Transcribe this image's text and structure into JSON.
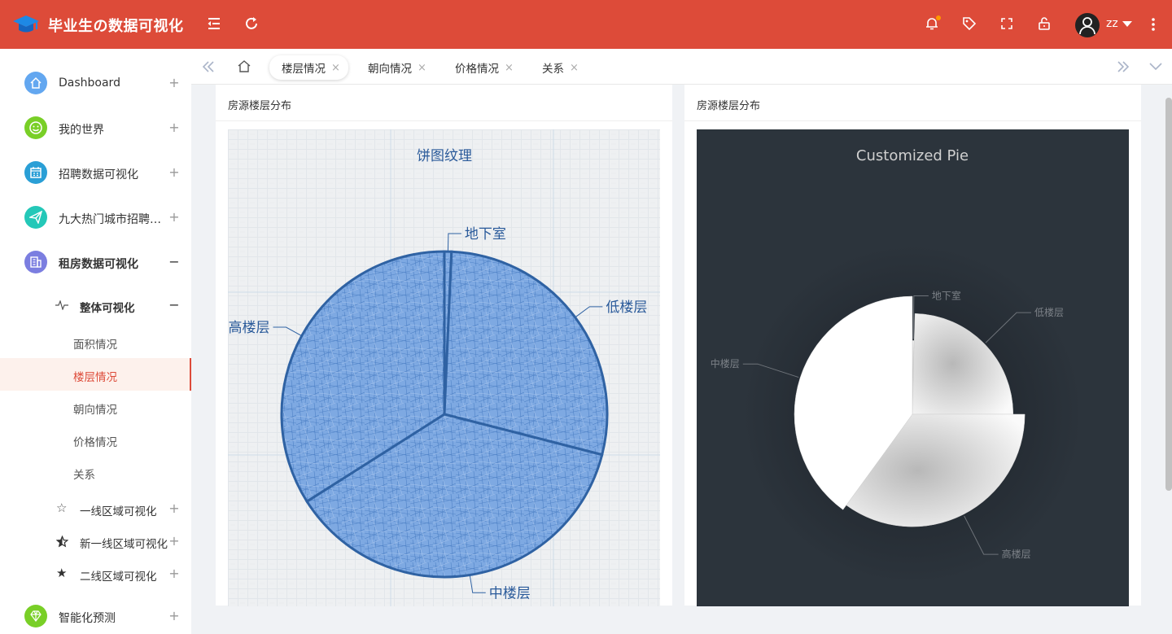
{
  "app": {
    "title": "毕业生の数据可视化",
    "username": "zz"
  },
  "colors": {
    "header": "#dd4b39",
    "active": "#dd4b39"
  },
  "header_icons": [
    "menu-fold-icon",
    "refresh-icon",
    "bell-icon",
    "tag-icon",
    "fullscreen-icon",
    "lock-icon",
    "user-avatar-icon",
    "caret-down-icon",
    "more-vertical-icon"
  ],
  "sidebar": {
    "items": [
      {
        "label": "Dashboard",
        "icon": "home-icon",
        "color": "#63a7f0",
        "toggle": "+"
      },
      {
        "label": "我的世界",
        "icon": "smile-icon",
        "color": "#79cf27",
        "toggle": "+"
      },
      {
        "label": "招聘数据可视化",
        "icon": "calendar-icon",
        "color": "#2a9fd6",
        "toggle": "+"
      },
      {
        "label": "九大热门城市招聘数据可视化",
        "icon": "send-icon",
        "color": "#24c8b8",
        "toggle": "+"
      },
      {
        "label": "租房数据可视化",
        "icon": "building-icon",
        "color": "#7b7ee0",
        "toggle": "−"
      }
    ],
    "group": {
      "label": "整体可视化",
      "icon": "pulse-icon",
      "toggle": "−"
    },
    "subitems": [
      "面积情况",
      "楼层情况",
      "朝向情况",
      "价格情况",
      "关系"
    ],
    "active_subitem": "楼层情况",
    "more": [
      {
        "label": "一线区域可视化",
        "icon": "star-outline-icon",
        "toggle": "+"
      },
      {
        "label": "新一线区域可视化",
        "icon": "star-half-icon",
        "toggle": "+"
      },
      {
        "label": "二线区域可视化",
        "icon": "star-filled-icon",
        "toggle": "+"
      }
    ],
    "last": {
      "label": "智能化预测",
      "icon": "diamond-icon",
      "color": "#79cf27",
      "toggle": "+"
    }
  },
  "tabs": {
    "home_icon": "home-icon",
    "items": [
      {
        "label": "楼层情况",
        "close": "×",
        "active": true
      },
      {
        "label": "朝向情况",
        "close": "×",
        "active": false
      },
      {
        "label": "价格情况",
        "close": "×",
        "active": false
      },
      {
        "label": "关系",
        "close": "×",
        "active": false
      }
    ]
  },
  "cards": [
    {
      "title": "房源楼层分布"
    },
    {
      "title": "房源楼层分布"
    }
  ],
  "chart_data": [
    {
      "type": "pie",
      "title": "饼图纹理",
      "slices": [
        {
          "name": "地下室",
          "value": 0.7
        },
        {
          "name": "低楼层",
          "value": 28.3
        },
        {
          "name": "中楼层",
          "value": 37
        },
        {
          "name": "高楼层",
          "value": 34
        }
      ]
    },
    {
      "type": "pie",
      "title": "Customized Pie",
      "rose": true,
      "slices": [
        {
          "name": "地下室",
          "value": 0.4
        },
        {
          "name": "低楼层",
          "value": 24.6
        },
        {
          "name": "高楼层",
          "value": 35
        },
        {
          "name": "中楼层",
          "value": 40
        }
      ]
    }
  ]
}
